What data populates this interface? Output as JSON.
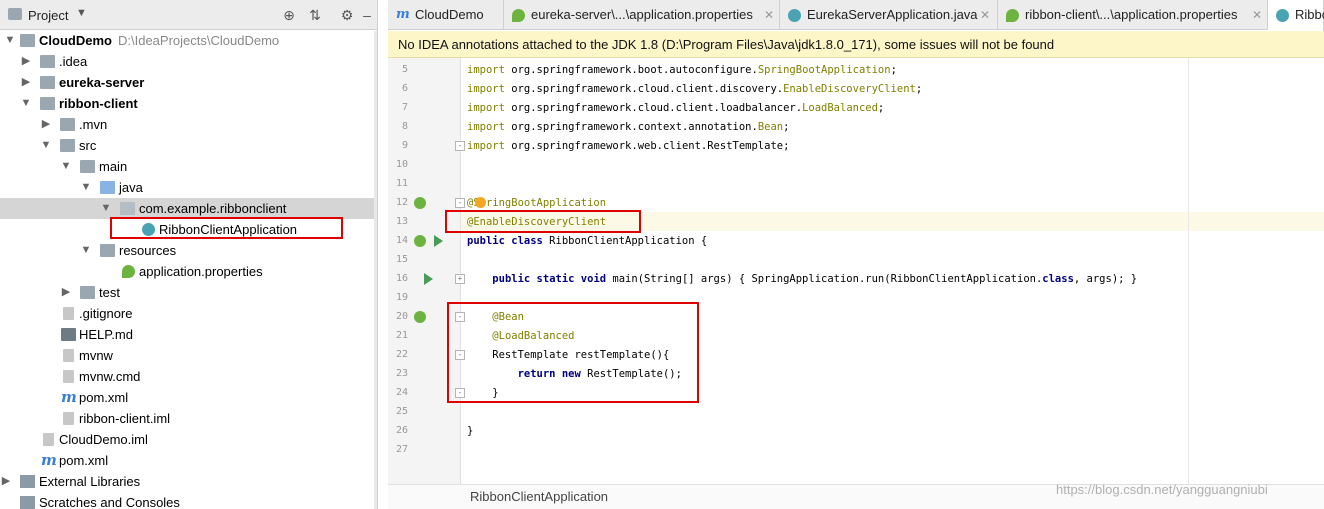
{
  "project_panel": {
    "title": "Project",
    "tree": [
      {
        "label": "CloudDemo",
        "path": "D:\\IdeaProjects\\CloudDemo",
        "icon": "module-folder-icon",
        "expanded": true
      },
      {
        "label": ".idea",
        "icon": "folder-icon",
        "expanded": false
      },
      {
        "label": "eureka-server",
        "icon": "module-folder-icon",
        "expanded": false
      },
      {
        "label": "ribbon-client",
        "icon": "module-folder-icon",
        "expanded": true
      },
      {
        "label": ".mvn",
        "icon": "folder-icon",
        "expanded": false
      },
      {
        "label": "src",
        "icon": "folder-icon",
        "expanded": true
      },
      {
        "label": "main",
        "icon": "folder-icon",
        "expanded": true
      },
      {
        "label": "java",
        "icon": "source-folder-icon",
        "expanded": true
      },
      {
        "label": "com.example.ribbonclient",
        "icon": "package-icon",
        "expanded": true
      },
      {
        "label": "RibbonClientApplication",
        "icon": "spring-boot-class-icon"
      },
      {
        "label": "resources",
        "icon": "resources-folder-icon",
        "expanded": true
      },
      {
        "label": "application.properties",
        "icon": "spring-properties-icon"
      },
      {
        "label": "test",
        "icon": "folder-icon",
        "expanded": false
      },
      {
        "label": ".gitignore",
        "icon": "file-icon"
      },
      {
        "label": "HELP.md",
        "icon": "markdown-icon"
      },
      {
        "label": "mvnw",
        "icon": "file-icon"
      },
      {
        "label": "mvnw.cmd",
        "icon": "file-icon"
      },
      {
        "label": "pom.xml",
        "icon": "maven-icon"
      },
      {
        "label": "ribbon-client.iml",
        "icon": "iml-file-icon"
      },
      {
        "label": "CloudDemo.iml",
        "icon": "iml-file-icon"
      },
      {
        "label": "pom.xml",
        "icon": "maven-icon"
      },
      {
        "label": "External Libraries",
        "icon": "libraries-icon",
        "expanded": false
      },
      {
        "label": "Scratches and Consoles",
        "icon": "scratches-icon"
      }
    ]
  },
  "tabs": [
    {
      "label": "CloudDemo",
      "icon": "maven-icon"
    },
    {
      "label": "eureka-server\\...\\application.properties",
      "icon": "spring-properties-icon"
    },
    {
      "label": "EurekaServerApplication.java",
      "icon": "spring-boot-class-icon"
    },
    {
      "label": "ribbon-client\\...\\application.properties",
      "icon": "spring-properties-icon"
    },
    {
      "label": "Ribbo",
      "icon": "spring-boot-class-icon",
      "active": true
    }
  ],
  "notification": "No IDEA annotations attached to the JDK 1.8 (D:\\Program Files\\Java\\jdk1.8.0_171), some issues will not be found",
  "editor": {
    "lines": [
      {
        "n": "5",
        "code": [
          [
            "imp",
            "import"
          ],
          [
            "",
            " org.springframework.boot.autoconfigure."
          ],
          [
            "ann",
            "SpringBootApplication"
          ],
          [
            "",
            ";"
          ]
        ]
      },
      {
        "n": "6",
        "code": [
          [
            "imp",
            "import"
          ],
          [
            "",
            " org.springframework.cloud.client.discovery."
          ],
          [
            "ann",
            "EnableDiscoveryClient"
          ],
          [
            "",
            ";"
          ]
        ]
      },
      {
        "n": "7",
        "code": [
          [
            "imp",
            "import"
          ],
          [
            "",
            " org.springframework.cloud.client.loadbalancer."
          ],
          [
            "ann",
            "LoadBalanced"
          ],
          [
            "",
            ";"
          ]
        ]
      },
      {
        "n": "8",
        "code": [
          [
            "imp",
            "import"
          ],
          [
            "",
            " org.springframework.context.annotation."
          ],
          [
            "ann",
            "Bean"
          ],
          [
            "",
            ";"
          ]
        ]
      },
      {
        "n": "9",
        "code": [
          [
            "imp",
            "import"
          ],
          [
            "",
            " org.springframework.web.client.RestTemplate;"
          ]
        ]
      },
      {
        "n": "10",
        "code": []
      },
      {
        "n": "11",
        "code": []
      },
      {
        "n": "12",
        "code": [
          [
            "ann",
            "@SpringBootApplication"
          ]
        ]
      },
      {
        "n": "13",
        "code": [
          [
            "ann",
            "@EnableDiscoveryClient"
          ]
        ]
      },
      {
        "n": "14",
        "code": [
          [
            "kw",
            "public class"
          ],
          [
            "",
            " RibbonClientApplication {"
          ]
        ]
      },
      {
        "n": "15",
        "code": []
      },
      {
        "n": "16",
        "code": [
          [
            "",
            "    "
          ],
          [
            "kw",
            "public static void"
          ],
          [
            "",
            " main(String[] args) { SpringApplication.run(RibbonClientApplication."
          ],
          [
            "kw",
            "class"
          ],
          [
            "",
            ", args); }"
          ]
        ]
      },
      {
        "n": "19",
        "code": []
      },
      {
        "n": "20",
        "code": [
          [
            "",
            "    "
          ],
          [
            "ann",
            "@Bean"
          ]
        ]
      },
      {
        "n": "21",
        "code": [
          [
            "",
            "    "
          ],
          [
            "ann",
            "@LoadBalanced"
          ]
        ]
      },
      {
        "n": "22",
        "code": [
          [
            "",
            "    RestTemplate restTemplate(){"
          ]
        ]
      },
      {
        "n": "23",
        "code": [
          [
            "",
            "        "
          ],
          [
            "kw",
            "return new"
          ],
          [
            "",
            " RestTemplate();"
          ]
        ]
      },
      {
        "n": "24",
        "code": [
          [
            "",
            "    }"
          ]
        ]
      },
      {
        "n": "25",
        "code": []
      },
      {
        "n": "26",
        "code": [
          [
            "",
            "}"
          ]
        ]
      },
      {
        "n": "27",
        "code": []
      }
    ]
  },
  "breadcrumb": "RibbonClientApplication",
  "watermark": "https://blog.csdn.net/yangguangniubi"
}
